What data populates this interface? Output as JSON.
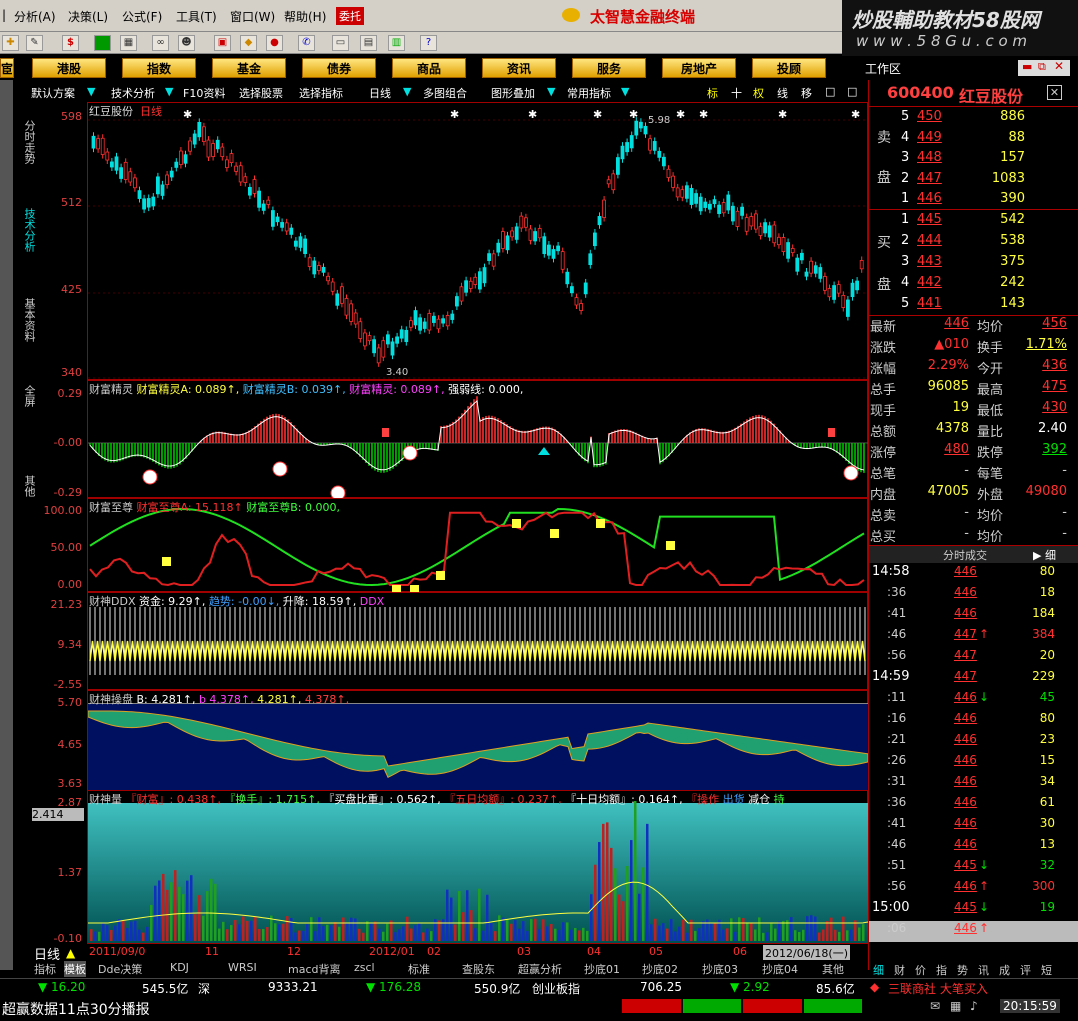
{
  "menu": {
    "items": [
      "分析(A)",
      "决策(L)",
      "公式(F)",
      "工具(T)",
      "窗口(W)",
      "帮助(H)"
    ],
    "entrust": "委托",
    "brand": "太智慧金融终端"
  },
  "watermark": {
    "line1": "炒股輔助教材58股网",
    "line2": "w w w . 5 8 G u . c o m"
  },
  "nav": {
    "items": [
      "港股",
      "指数",
      "基金",
      "债券",
      "商品",
      "资讯",
      "服务",
      "房地产",
      "投顾"
    ],
    "first": "宦",
    "workarea": "工作区"
  },
  "charttb": {
    "items": [
      "默认方案",
      "技术分析",
      "F10资料",
      "选择股票",
      "选择指标",
      "日线",
      "多图组合",
      "图形叠加",
      "常用指标"
    ],
    "right": [
      "标",
      "十",
      "权",
      "线",
      "移",
      "□",
      "□"
    ]
  },
  "sidetabs": [
    "分时走势",
    "技术分析",
    "基本资料",
    "全屏",
    "其他"
  ],
  "mainchart": {
    "title": "红豆股份",
    "period": "日线",
    "yticks": [
      "598",
      "512",
      "425",
      "340"
    ],
    "hi": "5.98",
    "lo": "3.40"
  },
  "panel1": {
    "name": "财富精灵",
    "a": "财富精灵A: 0.089↑,",
    "b": "财富精灵B: 0.039↑,",
    "c": "财富精灵: 0.089↑,",
    "d": "强弱线: 0.000,",
    "yticks": [
      "0.29",
      "-0.00",
      "-0.29"
    ]
  },
  "panel2": {
    "name": "财富至尊",
    "a": "财富至尊A: 15.118↑",
    "b": "财富至尊B: 0.000,",
    "yticks": [
      "100.00",
      "50.00",
      "0.00"
    ]
  },
  "panel3": {
    "name": "财神DDX",
    "a": "资金: 9.29↑,",
    "b": "趋势: -0.00↓,",
    "c": "升降: 18.59↑,",
    "d": "DDX",
    "yticks": [
      "21.23",
      "9.34",
      "-2.55"
    ]
  },
  "panel4": {
    "name": "财神操盘",
    "a": "B: 4.281↑,",
    "b": "b 4.378↑,",
    "c": "4.281↑,",
    "d": "4.378↑,",
    "yticks": [
      "5.70",
      "4.65",
      "3.63"
    ]
  },
  "panel5": {
    "name": "财神量",
    "items": [
      "『财富』: 0.438↑,",
      "『换手』: 1.715↑,",
      "『买盘比重』: 0.562↑,",
      "『五日均额』: 0.237↑,",
      "『十日均额』: 0.164↑,"
    ],
    "tail": [
      "『操作",
      "出货",
      "减仓",
      "持"
    ],
    "yticks": [
      "2.87",
      "2.414",
      "1.37",
      "-0.10"
    ]
  },
  "xaxis": [
    "2011/09/0",
    "11",
    "12",
    "2012/01",
    "02",
    "03",
    "04",
    "05",
    "06",
    "2012/06/18(一)"
  ],
  "indtabs": [
    "指标",
    "模板",
    "Dde决策",
    "KDJ",
    "WRSI",
    "macd背离",
    "zscl",
    "标准",
    "查股东",
    "超赢分析",
    "抄底01",
    "抄底02",
    "抄底03",
    "抄底04",
    "其他"
  ],
  "period_label": "日线",
  "stock": {
    "code": "600400",
    "name": "红豆股份"
  },
  "sell": [
    {
      "lv": "5",
      "p": "450",
      "v": "886"
    },
    {
      "lv": "4",
      "p": "449",
      "v": "88"
    },
    {
      "lv": "3",
      "p": "448",
      "v": "157"
    },
    {
      "lv": "2",
      "p": "447",
      "v": "1083"
    },
    {
      "lv": "1",
      "p": "446",
      "v": "390"
    }
  ],
  "buy": [
    {
      "lv": "1",
      "p": "445",
      "v": "542"
    },
    {
      "lv": "2",
      "p": "444",
      "v": "538"
    },
    {
      "lv": "3",
      "p": "443",
      "v": "375"
    },
    {
      "lv": "4",
      "p": "442",
      "v": "242"
    },
    {
      "lv": "5",
      "p": "441",
      "v": "143"
    }
  ],
  "sell_label": [
    "卖",
    "盘"
  ],
  "buy_label": [
    "买",
    "盘"
  ],
  "quote": [
    {
      "l1": "最新",
      "v1": "446",
      "l2": "均价",
      "v2": "456"
    },
    {
      "l1": "涨跌",
      "v1": "▲010",
      "l2": "换手",
      "v2": "1.71%"
    },
    {
      "l1": "涨幅",
      "v1": "2.29%",
      "l2": "今开",
      "v2": "436"
    },
    {
      "l1": "总手",
      "v1": "96085",
      "l2": "最高",
      "v2": "475"
    },
    {
      "l1": "现手",
      "v1": "19",
      "l2": "最低",
      "v2": "430"
    },
    {
      "l1": "总额",
      "v1": "4378",
      "l2": "量比",
      "v2": "2.40"
    },
    {
      "l1": "涨停",
      "v1": "480",
      "l2": "跌停",
      "v2": "392"
    },
    {
      "l1": "总笔",
      "v1": "-",
      "l2": "每笔",
      "v2": "-"
    },
    {
      "l1": "内盘",
      "v1": "47005",
      "l2": "外盘",
      "v2": "49080"
    },
    {
      "l1": "总卖",
      "v1": "-",
      "l2": "均价",
      "v2": "-"
    },
    {
      "l1": "总买",
      "v1": "-",
      "l2": "均价",
      "v2": "-"
    }
  ],
  "ticks_header": {
    "title": "分时成交",
    "detail": "细"
  },
  "ticks": [
    {
      "t": "14:58",
      "p": "446",
      "v": "80",
      "a": ""
    },
    {
      "t": ":36",
      "p": "446",
      "v": "18",
      "a": ""
    },
    {
      "t": ":41",
      "p": "446",
      "v": "184",
      "a": ""
    },
    {
      "t": ":46",
      "p": "447",
      "v": "384",
      "a": "up"
    },
    {
      "t": ":56",
      "p": "447",
      "v": "20",
      "a": ""
    },
    {
      "t": "14:59",
      "p": "447",
      "v": "229",
      "a": ""
    },
    {
      "t": ":11",
      "p": "446",
      "v": "45",
      "a": "down"
    },
    {
      "t": ":16",
      "p": "446",
      "v": "80",
      "a": ""
    },
    {
      "t": ":21",
      "p": "446",
      "v": "23",
      "a": ""
    },
    {
      "t": ":26",
      "p": "446",
      "v": "15",
      "a": ""
    },
    {
      "t": ":31",
      "p": "446",
      "v": "34",
      "a": ""
    },
    {
      "t": ":36",
      "p": "446",
      "v": "61",
      "a": ""
    },
    {
      "t": ":41",
      "p": "446",
      "v": "30",
      "a": ""
    },
    {
      "t": ":46",
      "p": "446",
      "v": "13",
      "a": ""
    },
    {
      "t": ":51",
      "p": "445",
      "v": "32",
      "a": "down"
    },
    {
      "t": ":56",
      "p": "446",
      "v": "300",
      "a": "up"
    },
    {
      "t": "15:00",
      "p": "445",
      "v": "19",
      "a": "down"
    },
    {
      "t": ":06",
      "p": "446",
      "v": "",
      "a": "up"
    }
  ],
  "rtabs": [
    "细",
    "财",
    "价",
    "指",
    "势",
    "讯",
    "成",
    "评",
    "短"
  ],
  "status": {
    "idx1": "▼ 16.20",
    "amt1": "545.5亿",
    "mk1": "深",
    "idx2": "9333.21",
    "chg2": "▼ 176.28",
    "amt2": "550.9亿",
    "mk2": "创业板指",
    "idx3": "706.25",
    "chg3": "▼ 2.92",
    "amt3": "85.6亿",
    "news": "三联商社 大笔买入",
    "time": "20:15:59",
    "ticker": "超赢数据11点30分播报"
  },
  "colors": {
    "up": "#ff3030",
    "down": "#00e000",
    "yellow": "#ffff40",
    "frame": "#a00000"
  }
}
